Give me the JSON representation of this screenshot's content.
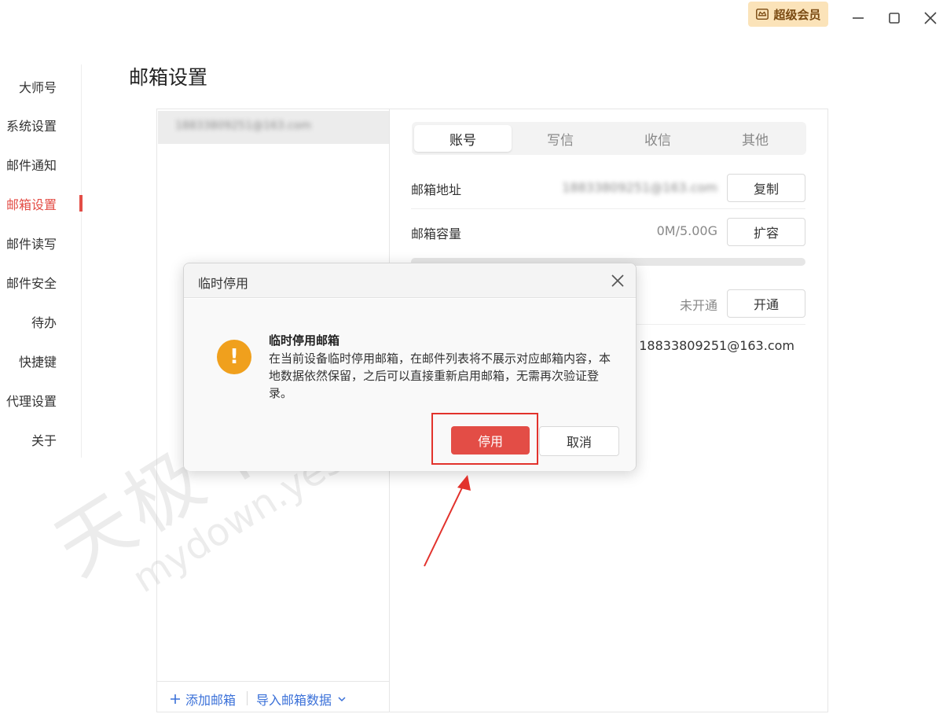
{
  "titlebar": {
    "vip_label": "超级会员",
    "minimize_icon": "minimize-icon",
    "maximize_icon": "maximize-icon",
    "close_icon": "close-icon"
  },
  "sidebar": {
    "items": [
      {
        "label": "大师号"
      },
      {
        "label": "系统设置"
      },
      {
        "label": "邮件通知"
      },
      {
        "label": "邮箱设置"
      },
      {
        "label": "邮件读写"
      },
      {
        "label": "邮件安全"
      },
      {
        "label": "待办"
      },
      {
        "label": "快捷键"
      },
      {
        "label": "代理设置"
      },
      {
        "label": "关于"
      }
    ],
    "active_index": 3
  },
  "page_title": "邮箱设置",
  "accounts": {
    "list": [
      {
        "email": "18833809251@163.com"
      }
    ],
    "add_label": "添加邮箱",
    "import_label": "导入邮箱数据"
  },
  "tabs": [
    {
      "label": "账号"
    },
    {
      "label": "写信"
    },
    {
      "label": "收信"
    },
    {
      "label": "其他"
    }
  ],
  "account_settings": {
    "address_label": "邮箱地址",
    "address_value": "18833809251@163.com",
    "copy_button": "复制",
    "capacity_label": "邮箱容量",
    "capacity_value": "0M/5.00G",
    "expand_button": "扩容",
    "capacity_used_fraction": 0,
    "service_status": "未开通",
    "open_button": "开通",
    "email_value": "18833809251@163.com"
  },
  "dialog": {
    "title": "临时停用",
    "heading": "临时停用邮箱",
    "message": "在当前设备临时停用邮箱，在邮件列表将不展示对应邮箱内容，本地数据依然保留，之后可以直接重新启用邮箱，无需再次验证登录。",
    "confirm_button": "停用",
    "cancel_button": "取消",
    "icon": "warning-icon"
  },
  "watermark": {
    "text_cn": "天极下载站",
    "text_url": "mydown.yesky.com"
  },
  "colors": {
    "accent": "#e34d46",
    "link": "#3a70d8",
    "warning": "#f0a01d",
    "vip_bg": "#fbe3b9"
  }
}
